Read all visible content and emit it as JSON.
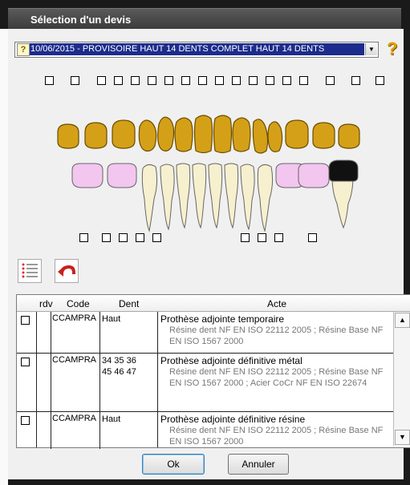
{
  "window": {
    "title": "Sélection d'un devis"
  },
  "devis_select": {
    "value": "10/06/2015 - PROVISOIRE HAUT 14 DENTS COMPLET HAUT 14 DENTS"
  },
  "table": {
    "headers": {
      "rdv": "rdv",
      "code": "Code",
      "dent": "Dent",
      "acte": "Acte"
    },
    "rows": [
      {
        "code": "CCAMPRA",
        "dent": "Haut",
        "acte": "Prothèse adjointe temporaire",
        "detail": "Résine dent NF EN ISO 22112 2005 ; Résine Base NF EN ISO 1567 2000"
      },
      {
        "code": "CCAMPRA",
        "dent": "34 35 36 45 46 47",
        "acte": "Prothèse adjointe définitive métal",
        "detail": "Résine dent NF EN ISO 22112 2005 ; Résine Base NF EN ISO 1567 2000 ; Acier CoCr NF EN ISO 22674"
      },
      {
        "code": "CCAMPRA",
        "dent": "Haut",
        "acte": "Prothèse adjointe définitive résine",
        "detail": "Résine dent NF EN ISO 22112 2005 ; Résine Base NF EN ISO 1567 2000"
      }
    ]
  },
  "buttons": {
    "ok": "Ok",
    "cancel": "Annuler"
  },
  "colors": {
    "prosthesis_gold": "#d4a017",
    "pink": "#f2c6ee",
    "natural": "#f7f0cf",
    "crown_black": "#111111",
    "selection": "#1c2c8c"
  }
}
